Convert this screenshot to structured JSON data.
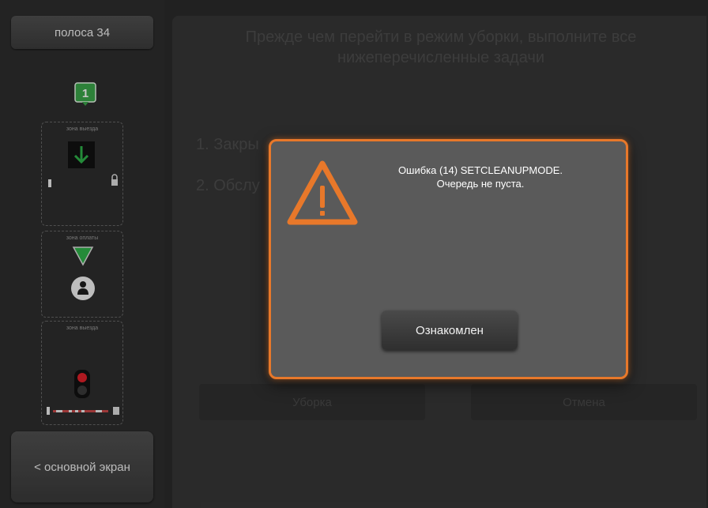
{
  "sidebar": {
    "lane_label": "полоса 34",
    "badge_number": "1",
    "zones": [
      "зона выезда",
      "зона оплаты",
      "зона выезда"
    ],
    "home_label": "< основной экран"
  },
  "main": {
    "instructions": "Прежде чем перейти в режим уборки, выполните все нижеперечисленные задачи",
    "steps": [
      "1. Закры",
      "2. Обслу"
    ],
    "cleanup_label": "Уборка",
    "cancel_label": "Отмена"
  },
  "dialog": {
    "message_line1": "Ошибка (14) SETCLEANUPMODE.",
    "message_line2": "Очередь не пуста.",
    "ok_label": "Ознакомлен"
  },
  "colors": {
    "accent": "#e8782a",
    "badge_green": "#3aa64a",
    "arrow_green": "#2fb24a"
  }
}
